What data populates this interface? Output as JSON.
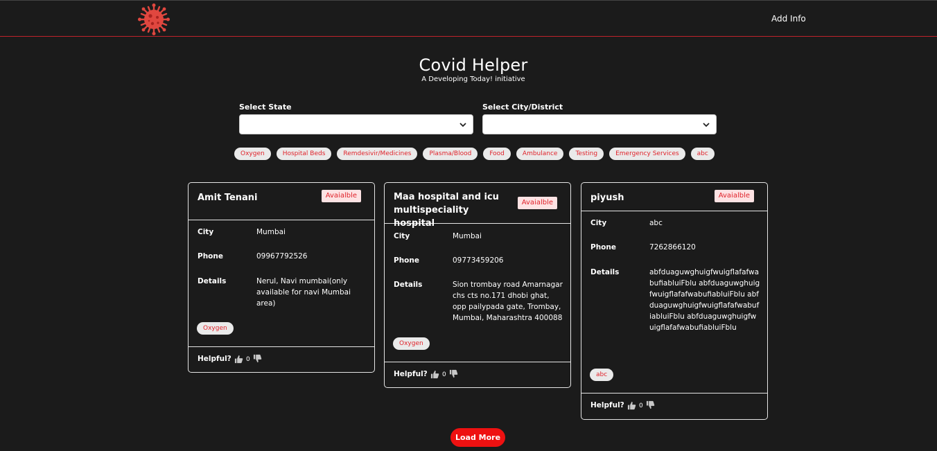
{
  "nav": {
    "add_info": "Add Info"
  },
  "hero": {
    "title": "Covid Helper",
    "subtitle": "A Developing Today! initiative"
  },
  "filters": {
    "state_label": "Select State",
    "state_value": "",
    "city_label": "Select City/District",
    "city_value": ""
  },
  "categories": [
    "Oxygen",
    "Hospital Beds",
    "Remdesivir/Medicines",
    "Plasma/Blood",
    "Food",
    "Ambulance",
    "Testing",
    "Emergency Services",
    "abc"
  ],
  "colors": {
    "background": "#1b1b1b",
    "accent": "#e0222a",
    "nav_border": "#c0232b",
    "button": "#ee1111"
  },
  "field_labels": {
    "city": "City",
    "phone": "Phone",
    "details": "Details",
    "helpful": "Helpful?"
  },
  "cards": [
    {
      "name": "Amit Tenani",
      "status": "Avaialble",
      "city": "Mumbai",
      "phone": "09967792526",
      "details": "Nerul, Navi mumbai(only available for navi Mumbai area)",
      "tag": "Oxygen",
      "helpful_count": "0"
    },
    {
      "name": "Maa hospital and icu multispeciality hospital",
      "status": "Avaialble",
      "city": "Mumbai",
      "phone": "09773459206",
      "details": "Sion trombay road Amarnagar chs cts no.171 dhobi ghat, opp pailypada gate, Trombay, Mumbai, Maharashtra 400088",
      "tag": "Oxygen",
      "helpful_count": "0"
    },
    {
      "name": "piyush",
      "status": "Avaialble",
      "city": "abc",
      "phone": "7262866120",
      "details": "abfduaguwghuigfwuigflafafwabufiabluiFblu abfduaguwghuigfwuigflafafwabufiabluiFblu abfduaguwghuigfwuigflafafwabufiabluiFblu abfduaguwghuigfwuigflafafwabufiabluiFblu",
      "tag": "abc",
      "helpful_count": "0"
    }
  ],
  "load_more": "Load More",
  "icons": {
    "logo": "virus-icon",
    "chevron": "chevron-down-icon",
    "up": "thumbs-up-icon",
    "down": "thumbs-down-icon"
  }
}
